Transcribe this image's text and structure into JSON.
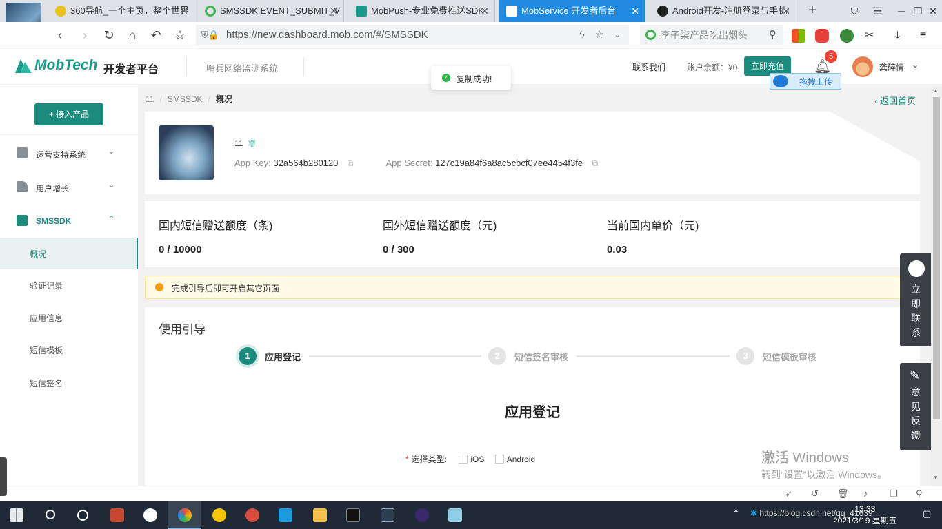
{
  "browser": {
    "tabs": [
      {
        "title": "360导航_一个主页，整个世界",
        "icon_color": "#e8c21a"
      },
      {
        "title": "SMSSDK.EVENT_SUBMIT_V",
        "icon_color": "#3fb34f"
      },
      {
        "title": "MobPush-专业免费推送SDK",
        "icon_color": "#1a9a8a"
      },
      {
        "title": "MobService 开发者后台",
        "icon_color": "#ffffff",
        "active": true
      },
      {
        "title": "Android开发-注册登录与手机",
        "icon_color": "#222222"
      }
    ],
    "url": "https://new.dashboard.mob.com/#/SMSSDK",
    "search_placeholder": "李子柒产品吃出烟头"
  },
  "header": {
    "logo_text": "MobTech",
    "platform": "开发者平台",
    "monitor": "哨兵网络监测系统",
    "contact": "联系我们",
    "balance": "账户余额：¥0",
    "recharge": "立即充值",
    "notifications": "5",
    "username": "龚碎情",
    "upload_label": "拖拽上传"
  },
  "toast": {
    "text": "复制成功!"
  },
  "sidebar": {
    "add_product": "+ 接入产品",
    "menus": [
      {
        "label": "运营支持系统",
        "expanded": false
      },
      {
        "label": "用户增长",
        "expanded": false
      },
      {
        "label": "SMSSDK",
        "expanded": true
      }
    ],
    "sub_items": [
      {
        "label": "概况",
        "active": true
      },
      {
        "label": "验证记录"
      },
      {
        "label": "应用信息"
      },
      {
        "label": "短信模板"
      },
      {
        "label": "短信签名"
      }
    ]
  },
  "breadcrumb": {
    "items": [
      "11",
      "SMSSDK",
      "概况"
    ]
  },
  "back_home": "返回首页",
  "app": {
    "name": "11",
    "key_label": "App Key:",
    "key": "32a564b280120",
    "secret_label": "App Secret:",
    "secret": "127c19a84f6a8ac5cbcf07ee4454f3fe"
  },
  "quota": [
    {
      "title": "国内短信赠送额度（条)",
      "value": "0 / 10000"
    },
    {
      "title": "国外短信赠送额度（元)",
      "value": "0 / 300"
    },
    {
      "title": "当前国内单价（元)",
      "value": "0.03"
    }
  ],
  "notice": "完成引导后即可开启其它页面",
  "guide": {
    "title": "使用引导",
    "steps": [
      {
        "num": "1",
        "label": "应用登记",
        "active": true
      },
      {
        "num": "2",
        "label": "短信签名审核"
      },
      {
        "num": "3",
        "label": "短信模板审核"
      }
    ],
    "section_title": "应用登记",
    "type_label": "选择类型:",
    "options": [
      "iOS",
      "Android"
    ]
  },
  "float_buttons": {
    "contact": [
      "立",
      "即",
      "联",
      "系"
    ],
    "feedback": [
      "意",
      "见",
      "反",
      "馈"
    ]
  },
  "watermark": {
    "line1": "激活 Windows",
    "line2": "转到“设置”以激活 Windows。"
  },
  "taskbar": {
    "tray_text": "https://blog.csdn.net/qq_41639",
    "time": "13:33",
    "date": "2021/3/19 星期五"
  },
  "colors": {
    "brand": "#1a8b7d",
    "active_tab": "#1f8ae0",
    "notice_bg": "#fffbe6"
  }
}
